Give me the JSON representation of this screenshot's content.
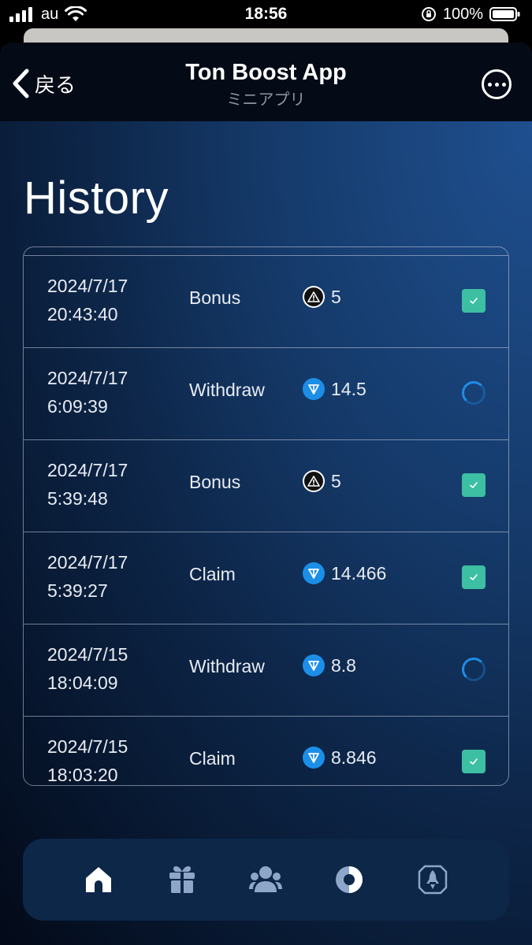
{
  "status_bar": {
    "carrier": "au",
    "time": "18:56",
    "battery": "100%"
  },
  "nav": {
    "back_label": "戻る",
    "title": "Ton Boost App",
    "subtitle": "ミニアプリ"
  },
  "page": {
    "title": "History"
  },
  "history": [
    {
      "date": "2024/7/17",
      "time": "20:43:40",
      "type": "Bonus",
      "amount": "5",
      "coin": "bonus",
      "status": "done"
    },
    {
      "date": "2024/7/17",
      "time": "6:09:39",
      "type": "Withdraw",
      "amount": "14.5",
      "coin": "ton",
      "status": "pending"
    },
    {
      "date": "2024/7/17",
      "time": "5:39:48",
      "type": "Bonus",
      "amount": "5",
      "coin": "bonus",
      "status": "done"
    },
    {
      "date": "2024/7/17",
      "time": "5:39:27",
      "type": "Claim",
      "amount": "14.466",
      "coin": "ton",
      "status": "done"
    },
    {
      "date": "2024/7/15",
      "time": "18:04:09",
      "type": "Withdraw",
      "amount": "8.8",
      "coin": "ton",
      "status": "pending"
    },
    {
      "date": "2024/7/15",
      "time": "18:03:20",
      "type": "Claim",
      "amount": "8.846",
      "coin": "ton",
      "status": "done"
    }
  ],
  "bottom_tabs": [
    {
      "icon": "home-icon"
    },
    {
      "icon": "gift-icon"
    },
    {
      "icon": "friends-icon"
    },
    {
      "icon": "stats-icon"
    },
    {
      "icon": "boost-icon"
    }
  ],
  "colors": {
    "done": "#3cbfa2",
    "pending": "#1e8de6",
    "ton": "#1b8ee8",
    "nav_bg": "#050b16",
    "tabbar_bg": "#0d2748"
  }
}
